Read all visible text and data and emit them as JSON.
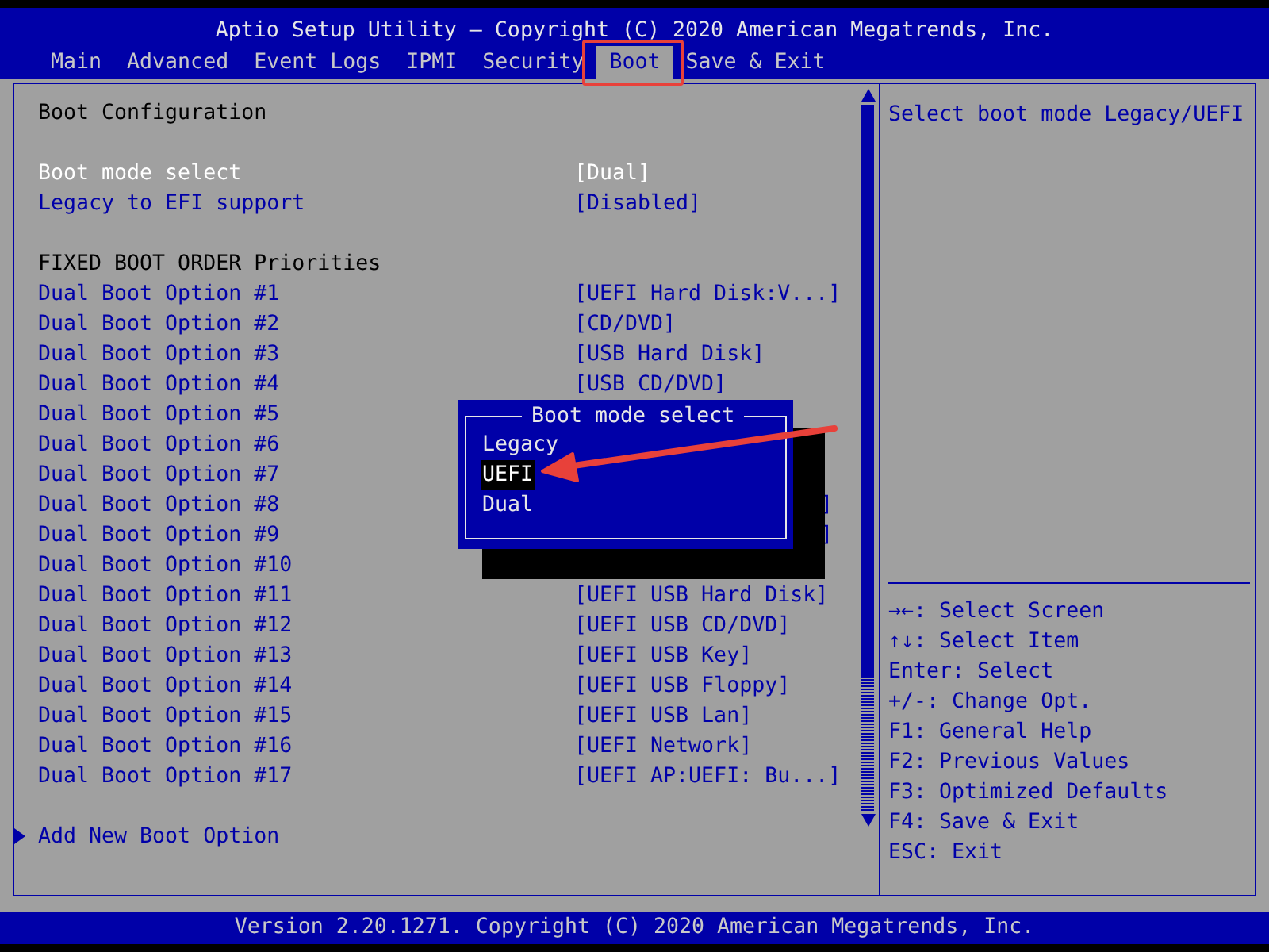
{
  "header": {
    "title": "Aptio Setup Utility – Copyright (C) 2020 American Megatrends, Inc."
  },
  "tabs": [
    {
      "label": "Main",
      "selected": false
    },
    {
      "label": "Advanced",
      "selected": false
    },
    {
      "label": "Event Logs",
      "selected": false
    },
    {
      "label": "IPMI",
      "selected": false
    },
    {
      "label": "Security",
      "selected": false
    },
    {
      "label": "Boot",
      "selected": true
    },
    {
      "label": "Save & Exit",
      "selected": false
    }
  ],
  "settings": [
    {
      "kind": "heading",
      "label": "Boot Configuration"
    },
    {
      "kind": "gap"
    },
    {
      "kind": "option",
      "label": "Boot mode select",
      "value": "[Dual]",
      "selected": true
    },
    {
      "kind": "option",
      "label": "Legacy to EFI support",
      "value": "[Disabled]",
      "selected": false
    },
    {
      "kind": "gap"
    },
    {
      "kind": "heading",
      "label": "FIXED BOOT ORDER Priorities"
    },
    {
      "kind": "option",
      "label": "Dual Boot Option #1",
      "value": "[UEFI Hard Disk:V...]",
      "selected": false
    },
    {
      "kind": "option",
      "label": "Dual Boot Option #2",
      "value": "[CD/DVD]",
      "selected": false
    },
    {
      "kind": "option",
      "label": "Dual Boot Option #3",
      "value": "[USB Hard Disk]",
      "selected": false
    },
    {
      "kind": "option",
      "label": "Dual Boot Option #4",
      "value": "[USB CD/DVD]",
      "selected": false
    },
    {
      "kind": "option",
      "label": "Dual Boot Option #5",
      "selected": false
    },
    {
      "kind": "option",
      "label": "Dual Boot Option #6",
      "selected": false
    },
    {
      "kind": "option",
      "label": "Dual Boot Option #7",
      "selected": false
    },
    {
      "kind": "option",
      "label": "Dual Boot Option #8",
      "value_tail": "]",
      "selected": false
    },
    {
      "kind": "option",
      "label": "Dual Boot Option #9",
      "value_tail": "]",
      "selected": false
    },
    {
      "kind": "option",
      "label": "Dual Boot Option #10",
      "selected": false
    },
    {
      "kind": "option",
      "label": "Dual Boot Option #11",
      "value": "[UEFI USB Hard Disk]",
      "selected": false
    },
    {
      "kind": "option",
      "label": "Dual Boot Option #12",
      "value": "[UEFI USB CD/DVD]",
      "selected": false
    },
    {
      "kind": "option",
      "label": "Dual Boot Option #13",
      "value": "[UEFI USB Key]",
      "selected": false
    },
    {
      "kind": "option",
      "label": "Dual Boot Option #14",
      "value": "[UEFI USB Floppy]",
      "selected": false
    },
    {
      "kind": "option",
      "label": "Dual Boot Option #15",
      "value": "[UEFI USB Lan]",
      "selected": false
    },
    {
      "kind": "option",
      "label": "Dual Boot Option #16",
      "value": "[UEFI Network]",
      "selected": false
    },
    {
      "kind": "option",
      "label": "Dual Boot Option #17",
      "value": "[UEFI AP:UEFI: Bu...]",
      "selected": false
    },
    {
      "kind": "gap"
    },
    {
      "kind": "submenu",
      "label": "Add New Boot Option"
    }
  ],
  "popup": {
    "title": "Boot mode select",
    "options": [
      {
        "label": "Legacy",
        "selected": false
      },
      {
        "label": "UEFI",
        "selected": true
      },
      {
        "label": "Dual",
        "selected": false
      }
    ]
  },
  "help_text": "Select boot mode Legacy/UEFI",
  "key_help": [
    "→←: Select Screen",
    "↑↓: Select Item",
    "Enter: Select",
    "+/-: Change Opt.",
    "F1: General Help",
    "F2: Previous Values",
    "F3: Optimized Defaults",
    "F4: Save & Exit",
    "ESC: Exit"
  ],
  "footer": {
    "text": "Version 2.20.1271. Copyright (C) 2020 American Megatrends, Inc."
  }
}
